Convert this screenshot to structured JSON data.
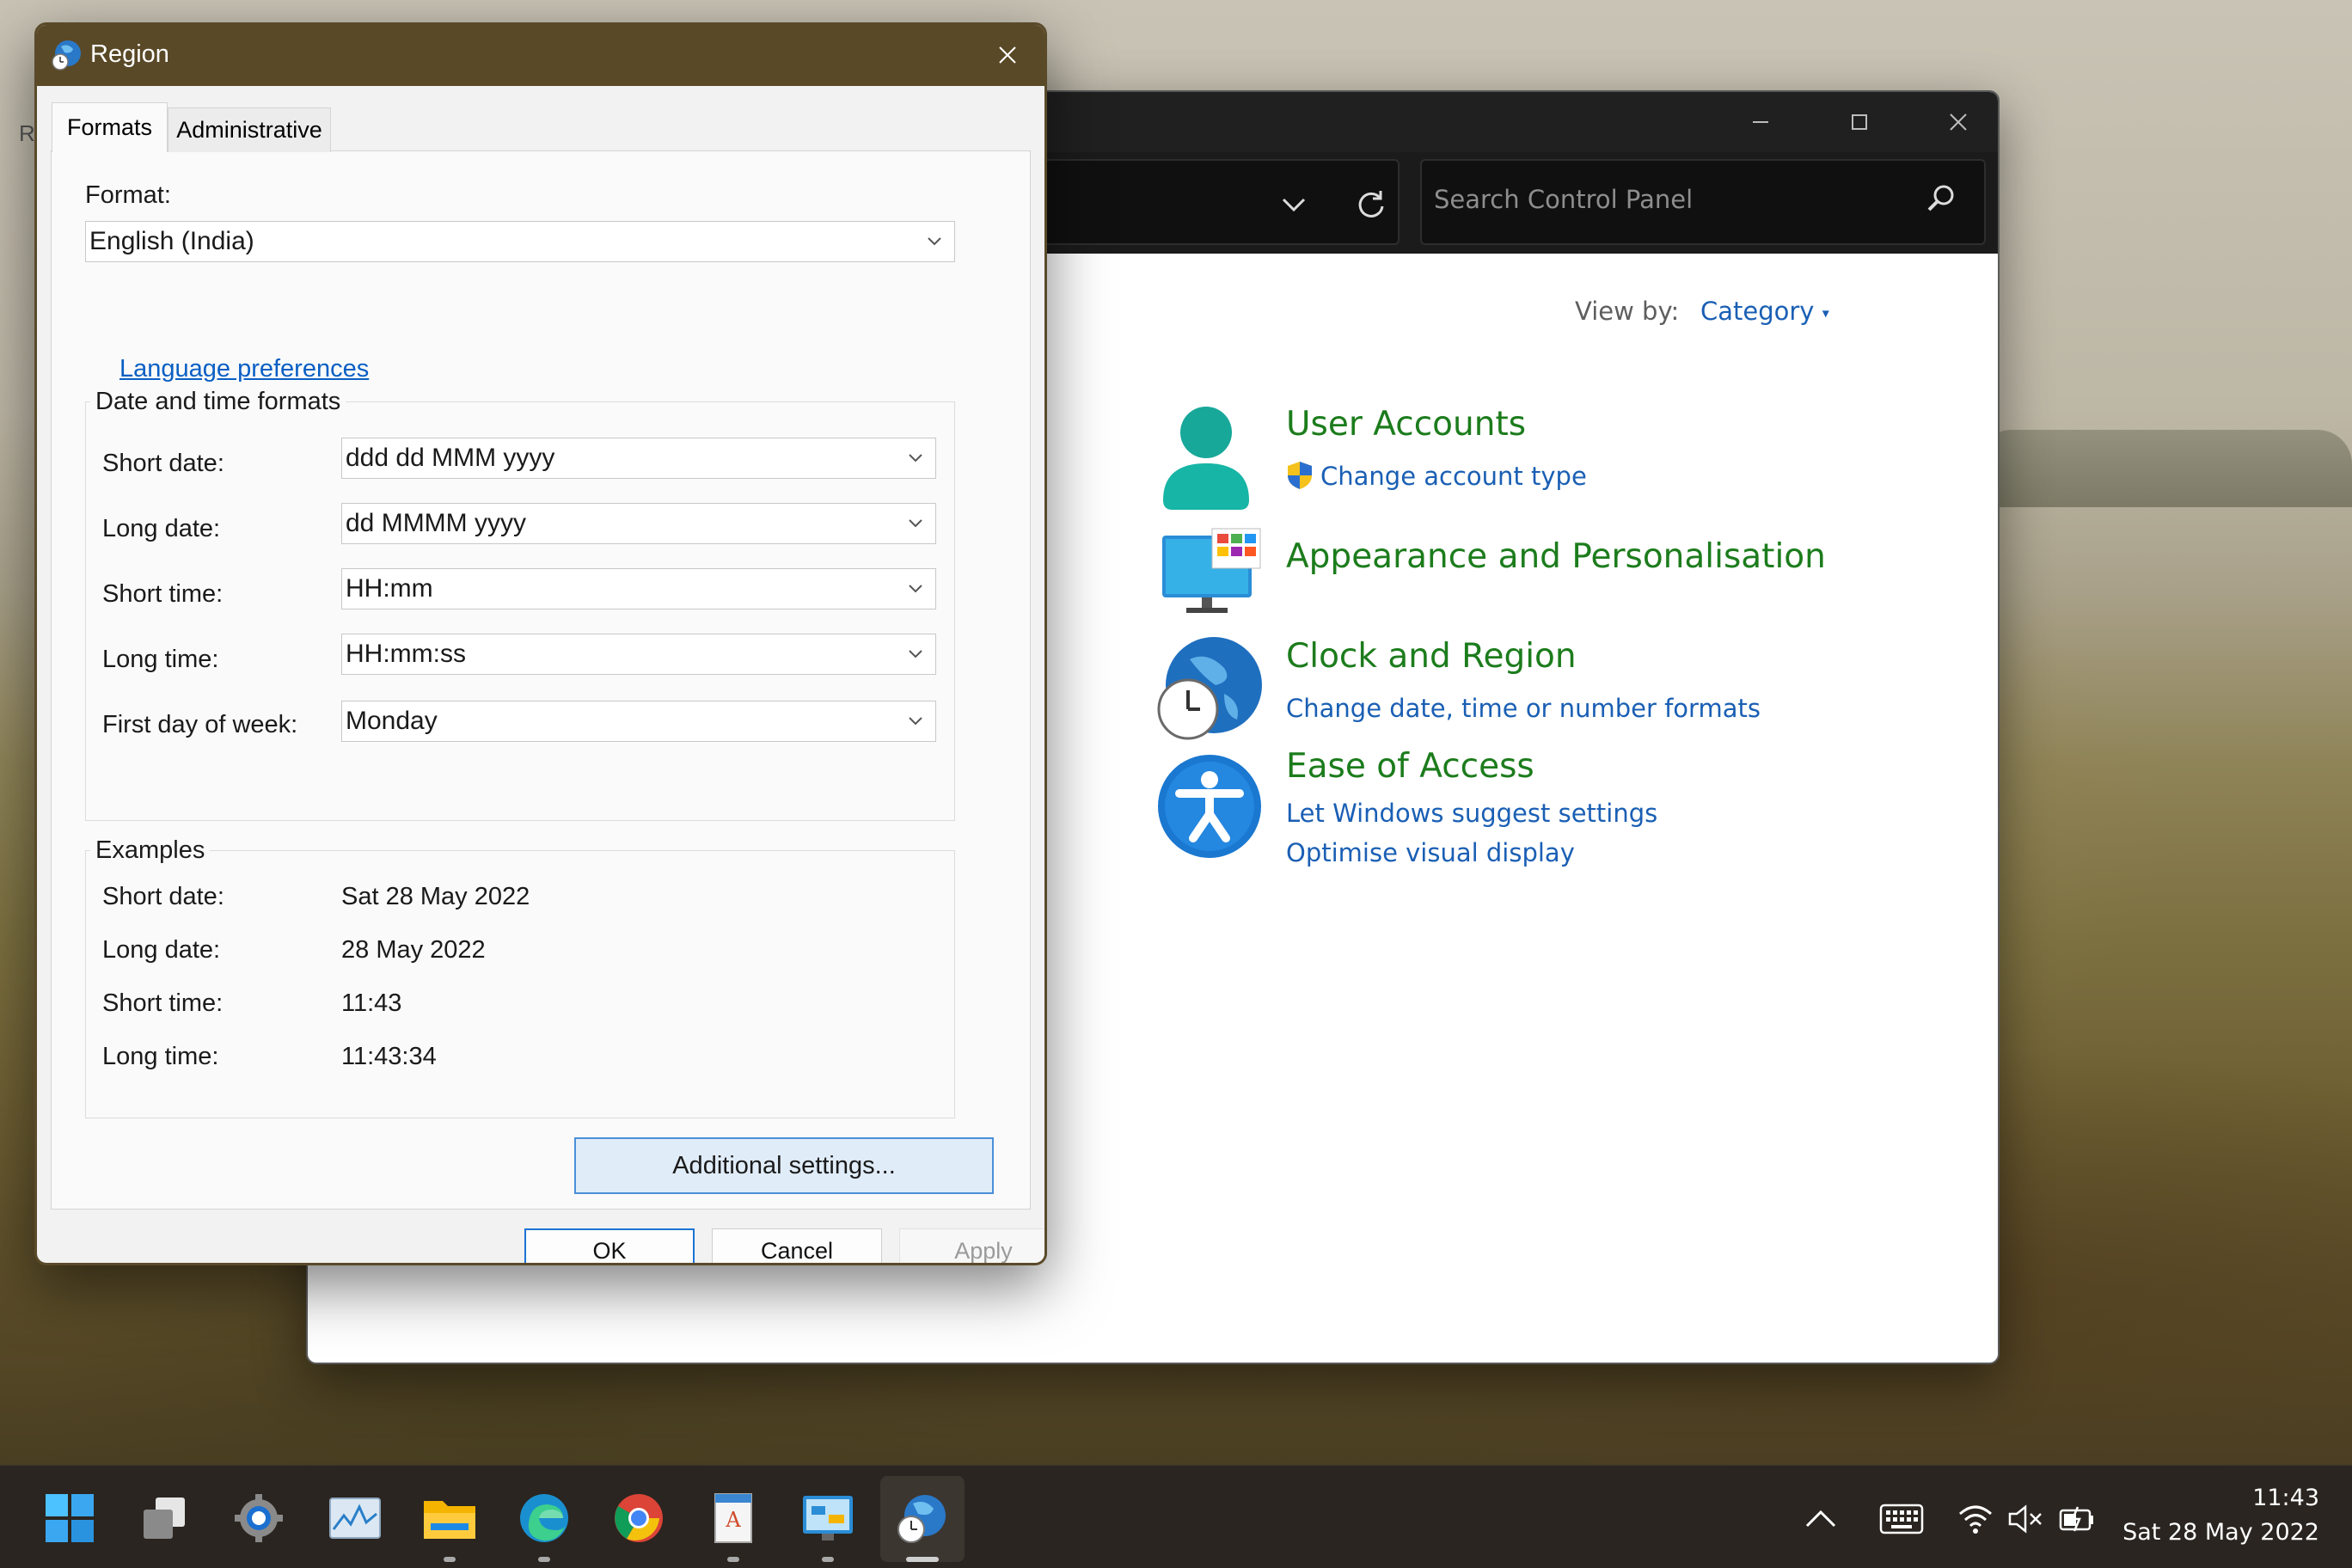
{
  "control_panel": {
    "search_placeholder": "Search Control Panel",
    "view_by_label": "View by:",
    "view_by_value": "Category",
    "categories": [
      {
        "title": "User Accounts",
        "links": [
          "Change account type"
        ]
      },
      {
        "title": "Appearance and Personalisation",
        "links": []
      },
      {
        "title": "Clock and Region",
        "links": [
          "Change date, time or number formats"
        ]
      },
      {
        "title": "Ease of Access",
        "links": [
          "Let Windows suggest settings",
          "Optimise visual display"
        ]
      }
    ],
    "icons": [
      "user-accounts-icon",
      "appearance-icon",
      "clock-region-icon",
      "ease-of-access-icon"
    ]
  },
  "region_dialog": {
    "title": "Region",
    "tabs": [
      "Formats",
      "Administrative"
    ],
    "format_label": "Format:",
    "format_value": "English (India)",
    "language_link": "Language preferences",
    "date_time_group": "Date and time formats",
    "fields": [
      {
        "label": "Short date:",
        "value": "ddd dd MMM yyyy"
      },
      {
        "label": "Long date:",
        "value": "dd MMMM yyyy"
      },
      {
        "label": "Short time:",
        "value": "HH:mm"
      },
      {
        "label": "Long time:",
        "value": "HH:mm:ss"
      },
      {
        "label": "First day of week:",
        "value": "Monday"
      }
    ],
    "examples_group": "Examples",
    "examples": [
      {
        "label": "Short date:",
        "value": "Sat 28 May 2022"
      },
      {
        "label": "Long date:",
        "value": "28 May 2022"
      },
      {
        "label": "Short time:",
        "value": "11:43"
      },
      {
        "label": "Long time:",
        "value": "11:43:34"
      }
    ],
    "additional_settings": "Additional settings...",
    "ok": "OK",
    "cancel": "Cancel",
    "apply": "Apply"
  },
  "taskbar": {
    "apps": [
      "start-icon",
      "task-view-icon",
      "settings-icon",
      "task-manager-icon",
      "file-explorer-icon",
      "edge-icon",
      "chrome-icon",
      "wordpad-icon",
      "control-panel-icon",
      "region-icon"
    ],
    "time": "11:43",
    "date": "Sat 28 May 2022"
  },
  "colors": {
    "accent": "#1a5fb4",
    "category_green": "#1c7c1c",
    "dialog_titlebar": "#5a4927"
  },
  "desktop": {
    "stray_letter": "R"
  }
}
